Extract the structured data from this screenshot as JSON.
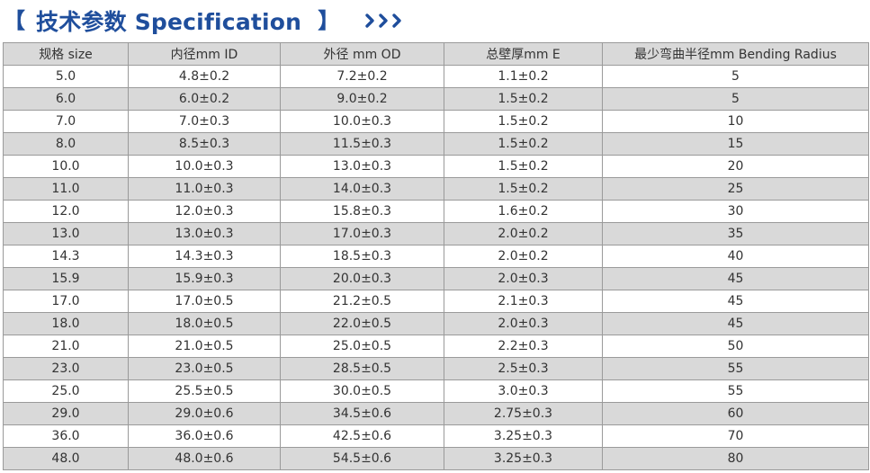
{
  "header": {
    "bracket_left": "【",
    "title": "技术参数 Specification",
    "bracket_right": "】",
    "accent_color": "#1f4e9c"
  },
  "table": {
    "columns": [
      "规格 size",
      "内径mm  ID",
      "外径 mm  OD",
      "总壁厚mm  E",
      "最少弯曲半径mm  Bending Radius"
    ],
    "rows": [
      [
        "5.0",
        "4.8±0.2",
        "7.2±0.2",
        "1.1±0.2",
        "5"
      ],
      [
        "6.0",
        "6.0±0.2",
        "9.0±0.2",
        "1.5±0.2",
        "5"
      ],
      [
        "7.0",
        "7.0±0.3",
        "10.0±0.3",
        "1.5±0.2",
        "10"
      ],
      [
        "8.0",
        "8.5±0.3",
        "11.5±0.3",
        "1.5±0.2",
        "15"
      ],
      [
        "10.0",
        "10.0±0.3",
        "13.0±0.3",
        "1.5±0.2",
        "20"
      ],
      [
        "11.0",
        "11.0±0.3",
        "14.0±0.3",
        "1.5±0.2",
        "25"
      ],
      [
        "12.0",
        "12.0±0.3",
        "15.8±0.3",
        "1.6±0.2",
        "30"
      ],
      [
        "13.0",
        "13.0±0.3",
        "17.0±0.3",
        "2.0±0.2",
        "35"
      ],
      [
        "14.3",
        "14.3±0.3",
        "18.5±0.3",
        "2.0±0.2",
        "40"
      ],
      [
        "15.9",
        "15.9±0.3",
        "20.0±0.3",
        "2.0±0.3",
        "45"
      ],
      [
        "17.0",
        "17.0±0.5",
        "21.2±0.5",
        "2.1±0.3",
        "45"
      ],
      [
        "18.0",
        "18.0±0.5",
        "22.0±0.5",
        "2.0±0.3",
        "45"
      ],
      [
        "21.0",
        "21.0±0.5",
        "25.0±0.5",
        "2.2±0.3",
        "50"
      ],
      [
        "23.0",
        "23.0±0.5",
        "28.5±0.5",
        "2.5±0.3",
        "55"
      ],
      [
        "25.0",
        "25.5±0.5",
        "30.0±0.5",
        "3.0±0.3",
        "55"
      ],
      [
        "29.0",
        "29.0±0.6",
        "34.5±0.6",
        "2.75±0.3",
        "60"
      ],
      [
        "36.0",
        "36.0±0.6",
        "42.5±0.6",
        "3.25±0.3",
        "70"
      ],
      [
        "48.0",
        "48.0±0.6",
        "54.5±0.6",
        "3.25±0.3",
        "80"
      ]
    ]
  }
}
